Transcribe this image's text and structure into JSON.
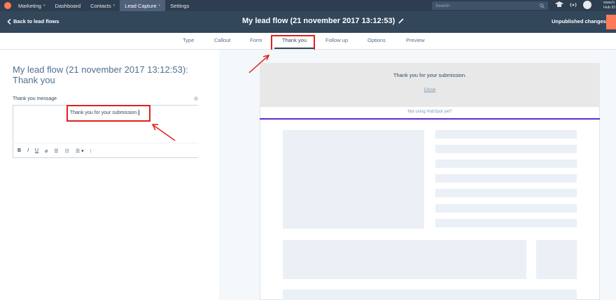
{
  "topnav": {
    "items": [
      {
        "label": "Marketing",
        "caret": "▾"
      },
      {
        "label": "Dashboard",
        "caret": ""
      },
      {
        "label": "Contacts",
        "caret": "▾"
      },
      {
        "label": "Lead Capture",
        "caret": "▾"
      },
      {
        "label": "Settings",
        "caret": ""
      }
    ],
    "active_index": 3,
    "search_placeholder": "Search",
    "hub_info_line1": "www.h",
    "hub_info_line2": "Hub ID"
  },
  "titlebar": {
    "back_label": "Back to lead flows",
    "title": "My lead flow (21 november 2017 13:12:53)",
    "status": "Unpublished changes"
  },
  "tabs": [
    "Type",
    "Callout",
    "Form",
    "Thank you",
    "Follow up",
    "Options",
    "Preview"
  ],
  "active_tab": "Thank you",
  "editor_panel": {
    "heading": "My lead flow (21 november 2017 13:12:53): Thank you",
    "field_label": "Thank you message",
    "message": "Thank you for your submission.",
    "toolbar": [
      "B",
      "I",
      "U",
      "⌀",
      "☰",
      "☷",
      "☰ ▾",
      "⁝"
    ]
  },
  "preview": {
    "thanks_text": "Thank you for your submission.",
    "close_label": "Close",
    "footer_text": "Not using HubSpot yet?"
  },
  "colors": {
    "nav_bg": "#2d3e50",
    "title_bg": "#33475b",
    "accent_orange": "#ff7a59",
    "highlight_red": "#e0201b",
    "preview_accent": "#5c2ccf"
  }
}
